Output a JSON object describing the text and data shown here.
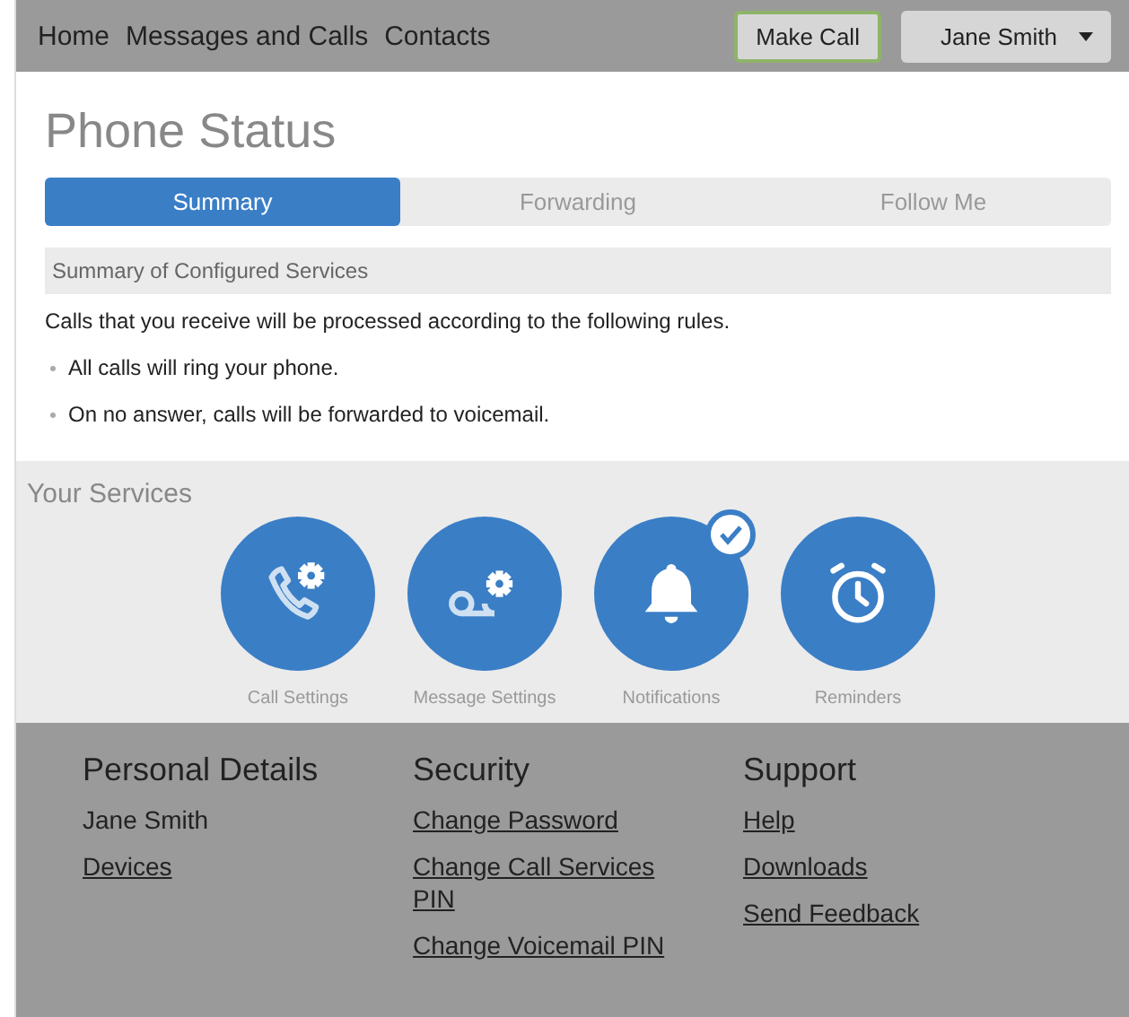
{
  "nav": {
    "links": [
      "Home",
      "Messages and Calls",
      "Contacts"
    ],
    "make_call": "Make Call",
    "user": "Jane Smith"
  },
  "title": "Phone Status",
  "tabs": [
    {
      "label": "Summary",
      "selected": true
    },
    {
      "label": "Forwarding",
      "selected": false
    },
    {
      "label": "Follow Me",
      "selected": false
    }
  ],
  "summary": {
    "heading": "Summary of Configured Services",
    "intro": "Calls that you receive will be processed according to the following rules.",
    "rules": [
      "All calls will ring your phone.",
      "On no answer, calls will be forwarded to voicemail."
    ]
  },
  "services": {
    "heading": "Your Services",
    "items": [
      {
        "kind": "call",
        "label": "Call Settings",
        "checked": false
      },
      {
        "kind": "voicemail",
        "label": "Message Settings",
        "checked": false
      },
      {
        "kind": "bell",
        "label": "Notifications",
        "checked": true
      },
      {
        "kind": "clock",
        "label": "Reminders",
        "checked": false
      }
    ]
  },
  "footer": [
    {
      "heading": "Personal Details",
      "items": [
        {
          "text": "Jane Smith",
          "link": false
        },
        {
          "text": "Devices",
          "link": true
        }
      ]
    },
    {
      "heading": "Security",
      "items": [
        {
          "text": "Change Password",
          "link": true
        },
        {
          "text": "Change Call Services PIN",
          "link": true
        },
        {
          "text": "Change Voicemail PIN",
          "link": true
        }
      ]
    },
    {
      "heading": "Support",
      "items": [
        {
          "text": "Help",
          "link": true
        },
        {
          "text": "Downloads",
          "link": true
        },
        {
          "text": "Send Feedback",
          "link": true
        }
      ]
    }
  ]
}
